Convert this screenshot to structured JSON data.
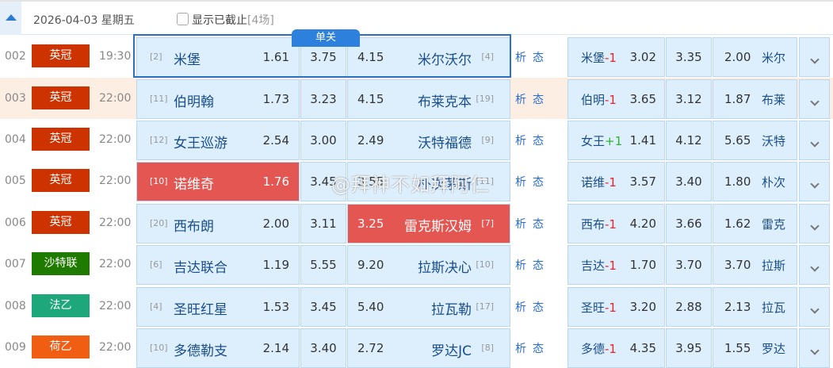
{
  "header": {
    "date": "2026-04-03 星期五",
    "show_closed_label": "显示已截止",
    "closed_count": "[4场]"
  },
  "single_tag": "单关",
  "analysis": {
    "xi": "析",
    "tai": "态"
  },
  "watermark": "@拜神不如拜阿仁",
  "colors": {
    "red": "#e45652",
    "cell": "#ddeff d",
    "yingguan": "#cc3300",
    "shatelian": "#1f7a00",
    "fayi": "#1ea77a",
    "heyi": "#f05e14"
  },
  "rows": [
    {
      "num": "002",
      "league": "英冠",
      "league_color": "#cc3300",
      "time": "19:30",
      "home_rank": "[2]",
      "home": "米堡",
      "h_odd": "1.61",
      "d_odd": "3.75",
      "a_odd": "4.15",
      "away": "米尔沃尔",
      "away_rank": "[4]",
      "hc_team": "米堡",
      "hc": "-1",
      "hc_h": "3.02",
      "hc_d": "3.35",
      "hc_a": "2.00",
      "hc_away": "米尔"
    },
    {
      "num": "003",
      "league": "英冠",
      "league_color": "#cc3300",
      "time": "22:00",
      "home_rank": "[11]",
      "home": "伯明翰",
      "h_odd": "1.73",
      "d_odd": "3.23",
      "a_odd": "4.15",
      "away": "布莱克本",
      "away_rank": "[19]",
      "hc_team": "伯明",
      "hc": "-1",
      "hc_h": "3.65",
      "hc_d": "3.12",
      "hc_a": "1.87",
      "hc_away": "布莱"
    },
    {
      "num": "004",
      "league": "英冠",
      "league_color": "#cc3300",
      "time": "22:00",
      "home_rank": "[12]",
      "home": "女王巡游",
      "h_odd": "2.54",
      "d_odd": "3.00",
      "a_odd": "2.49",
      "away": "沃特福德",
      "away_rank": "[9]",
      "hc_team": "女王",
      "hc": "+1",
      "hc_h": "1.41",
      "hc_d": "4.12",
      "hc_a": "5.65",
      "hc_away": "沃特"
    },
    {
      "num": "005",
      "league": "英冠",
      "league_color": "#cc3300",
      "time": "22:00",
      "home_rank": "[10]",
      "home": "诺维奇",
      "h_odd": "1.76",
      "d_odd": "3.45",
      "a_odd": "3.55",
      "away": "朴次茅斯",
      "away_rank": "[11]",
      "hc_team": "诺维",
      "hc": "-1",
      "hc_h": "3.57",
      "hc_d": "3.40",
      "hc_a": "1.80",
      "hc_away": "朴次"
    },
    {
      "num": "006",
      "league": "英冠",
      "league_color": "#cc3300",
      "time": "22:00",
      "home_rank": "[20]",
      "home": "西布朗",
      "h_odd": "2.00",
      "d_odd": "3.11",
      "a_odd": "3.25",
      "away": "雷克斯汉姆",
      "away_rank": "[7]",
      "hc_team": "西布",
      "hc": "-1",
      "hc_h": "4.20",
      "hc_d": "3.66",
      "hc_a": "1.62",
      "hc_away": "雷克"
    },
    {
      "num": "007",
      "league": "沙特联",
      "league_color": "#1f7a00",
      "time": "22:00",
      "home_rank": "[6]",
      "home": "吉达联合",
      "h_odd": "1.19",
      "d_odd": "5.55",
      "a_odd": "9.20",
      "away": "拉斯决心",
      "away_rank": "[10]",
      "hc_team": "吉达",
      "hc": "-1",
      "hc_h": "1.70",
      "hc_d": "3.70",
      "hc_a": "3.70",
      "hc_away": "拉斯"
    },
    {
      "num": "008",
      "league": "法乙",
      "league_color": "#1ea77a",
      "time": "22:00",
      "home_rank": "[4]",
      "home": "圣旺红星",
      "h_odd": "1.53",
      "d_odd": "3.45",
      "a_odd": "5.40",
      "away": "拉瓦勒",
      "away_rank": "[17]",
      "hc_team": "圣旺",
      "hc": "-1",
      "hc_h": "3.20",
      "hc_d": "2.88",
      "hc_a": "2.13",
      "hc_away": "拉瓦"
    },
    {
      "num": "009",
      "league": "荷乙",
      "league_color": "#f05e14",
      "time": "22:00",
      "home_rank": "[10]",
      "home": "多德勒支",
      "h_odd": "2.14",
      "d_odd": "3.40",
      "a_odd": "2.72",
      "away": "罗达JC",
      "away_rank": "[8]",
      "hc_team": "多德",
      "hc": "-1",
      "hc_h": "4.35",
      "hc_d": "3.95",
      "hc_a": "1.55",
      "hc_away": "罗达"
    }
  ]
}
